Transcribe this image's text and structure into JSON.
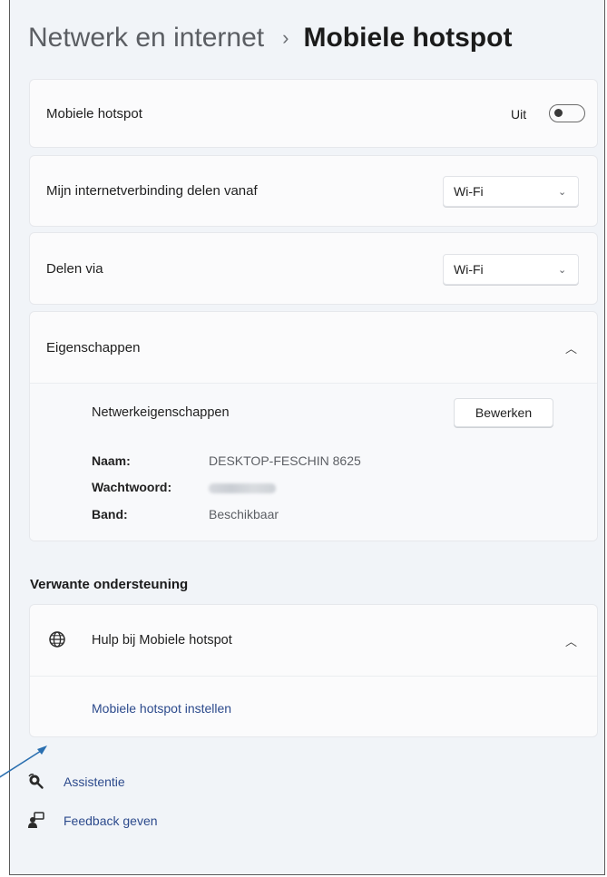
{
  "header": {
    "breadcrumb": "Netwerk en internet",
    "separator": "›",
    "title": "Mobiele hotspot"
  },
  "hotspot": {
    "label": "Mobiele hotspot",
    "toggle_state_text": "Uit",
    "toggle_on": false
  },
  "share_from": {
    "label": "Mijn internetverbinding delen vanaf",
    "selected": "Wi-Fi"
  },
  "share_via": {
    "label": "Delen via",
    "selected": "Wi-Fi"
  },
  "properties": {
    "label": "Eigenschappen",
    "network_props_label": "Netwerkeigenschappen",
    "edit_label": "Bewerken",
    "rows": [
      {
        "key": "Naam:",
        "value": "DESKTOP-FESCHIN 8625"
      },
      {
        "key": "Wachtwoord:",
        "value": ""
      },
      {
        "key": "Band:",
        "value": "Beschikbaar"
      }
    ]
  },
  "related": {
    "heading": "Verwante ondersteuning",
    "help_label": "Hulp bij Mobiele hotspot",
    "help_link": "Mobiele hotspot instellen"
  },
  "footer": {
    "assist_label": "Assistentie",
    "feedback_label": "Feedback geven"
  },
  "colors": {
    "accent_link": "#2c4a8c",
    "arrow": "#2a6fb0"
  }
}
